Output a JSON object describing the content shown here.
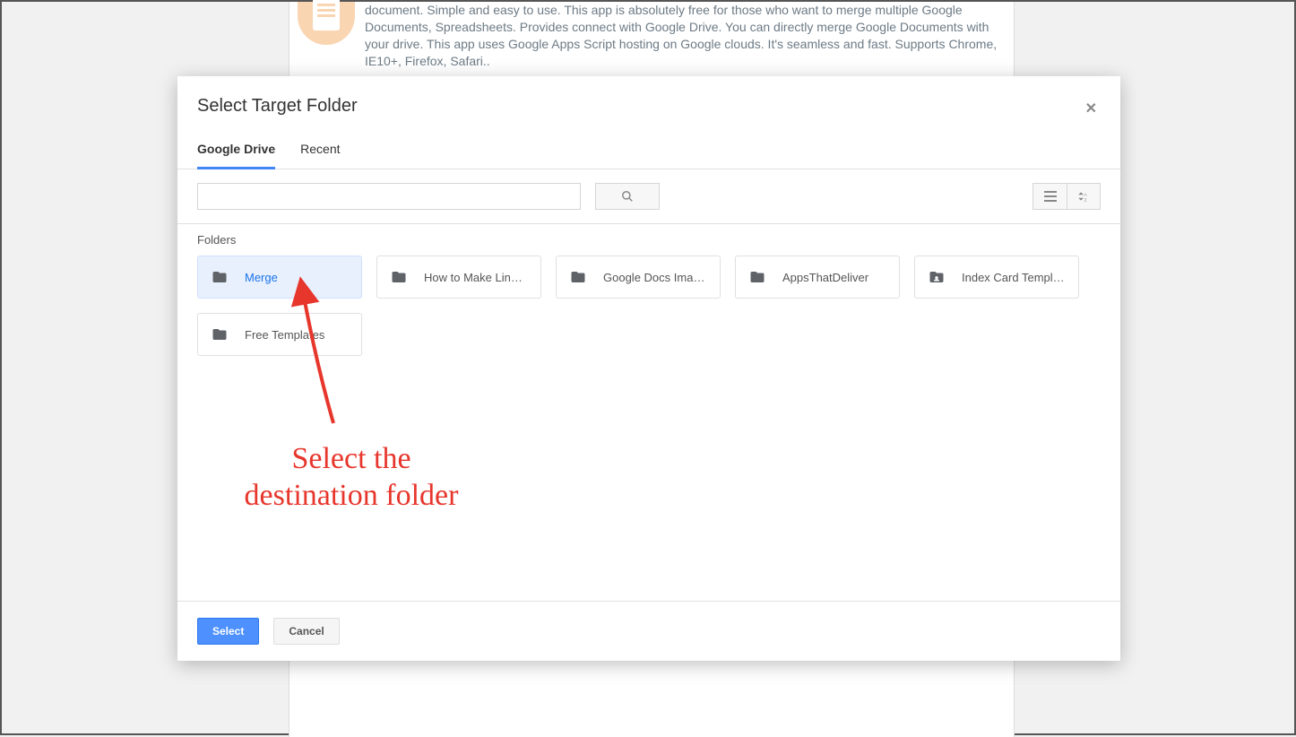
{
  "background": {
    "text": "document. Simple and easy to use. This app is absolutely free for those who want to merge multiple Google Documents, Spreadsheets. Provides connect with Google Drive. You can directly merge Google Documents with your drive.\nThis app uses Google Apps Script hosting on Google clouds. It's seamless and fast. Supports Chrome, IE10+, Firefox, Safari.."
  },
  "dialog": {
    "title": "Select Target Folder",
    "tabs": {
      "drive": "Google Drive",
      "recent": "Recent"
    },
    "section_label": "Folders",
    "folders": [
      {
        "label": "Merge",
        "selected": true,
        "icon": "folder"
      },
      {
        "label": "How to Make Line…",
        "selected": false,
        "icon": "folder"
      },
      {
        "label": "Google Docs Imag…",
        "selected": false,
        "icon": "folder"
      },
      {
        "label": "AppsThatDeliver",
        "selected": false,
        "icon": "folder"
      },
      {
        "label": "Index Card Templ…",
        "selected": false,
        "icon": "shared-folder"
      },
      {
        "label": "Free Templates",
        "selected": false,
        "icon": "folder"
      }
    ],
    "footer": {
      "select": "Select",
      "cancel": "Cancel"
    }
  },
  "annotation": {
    "text": "Select the\ndestination folder"
  }
}
